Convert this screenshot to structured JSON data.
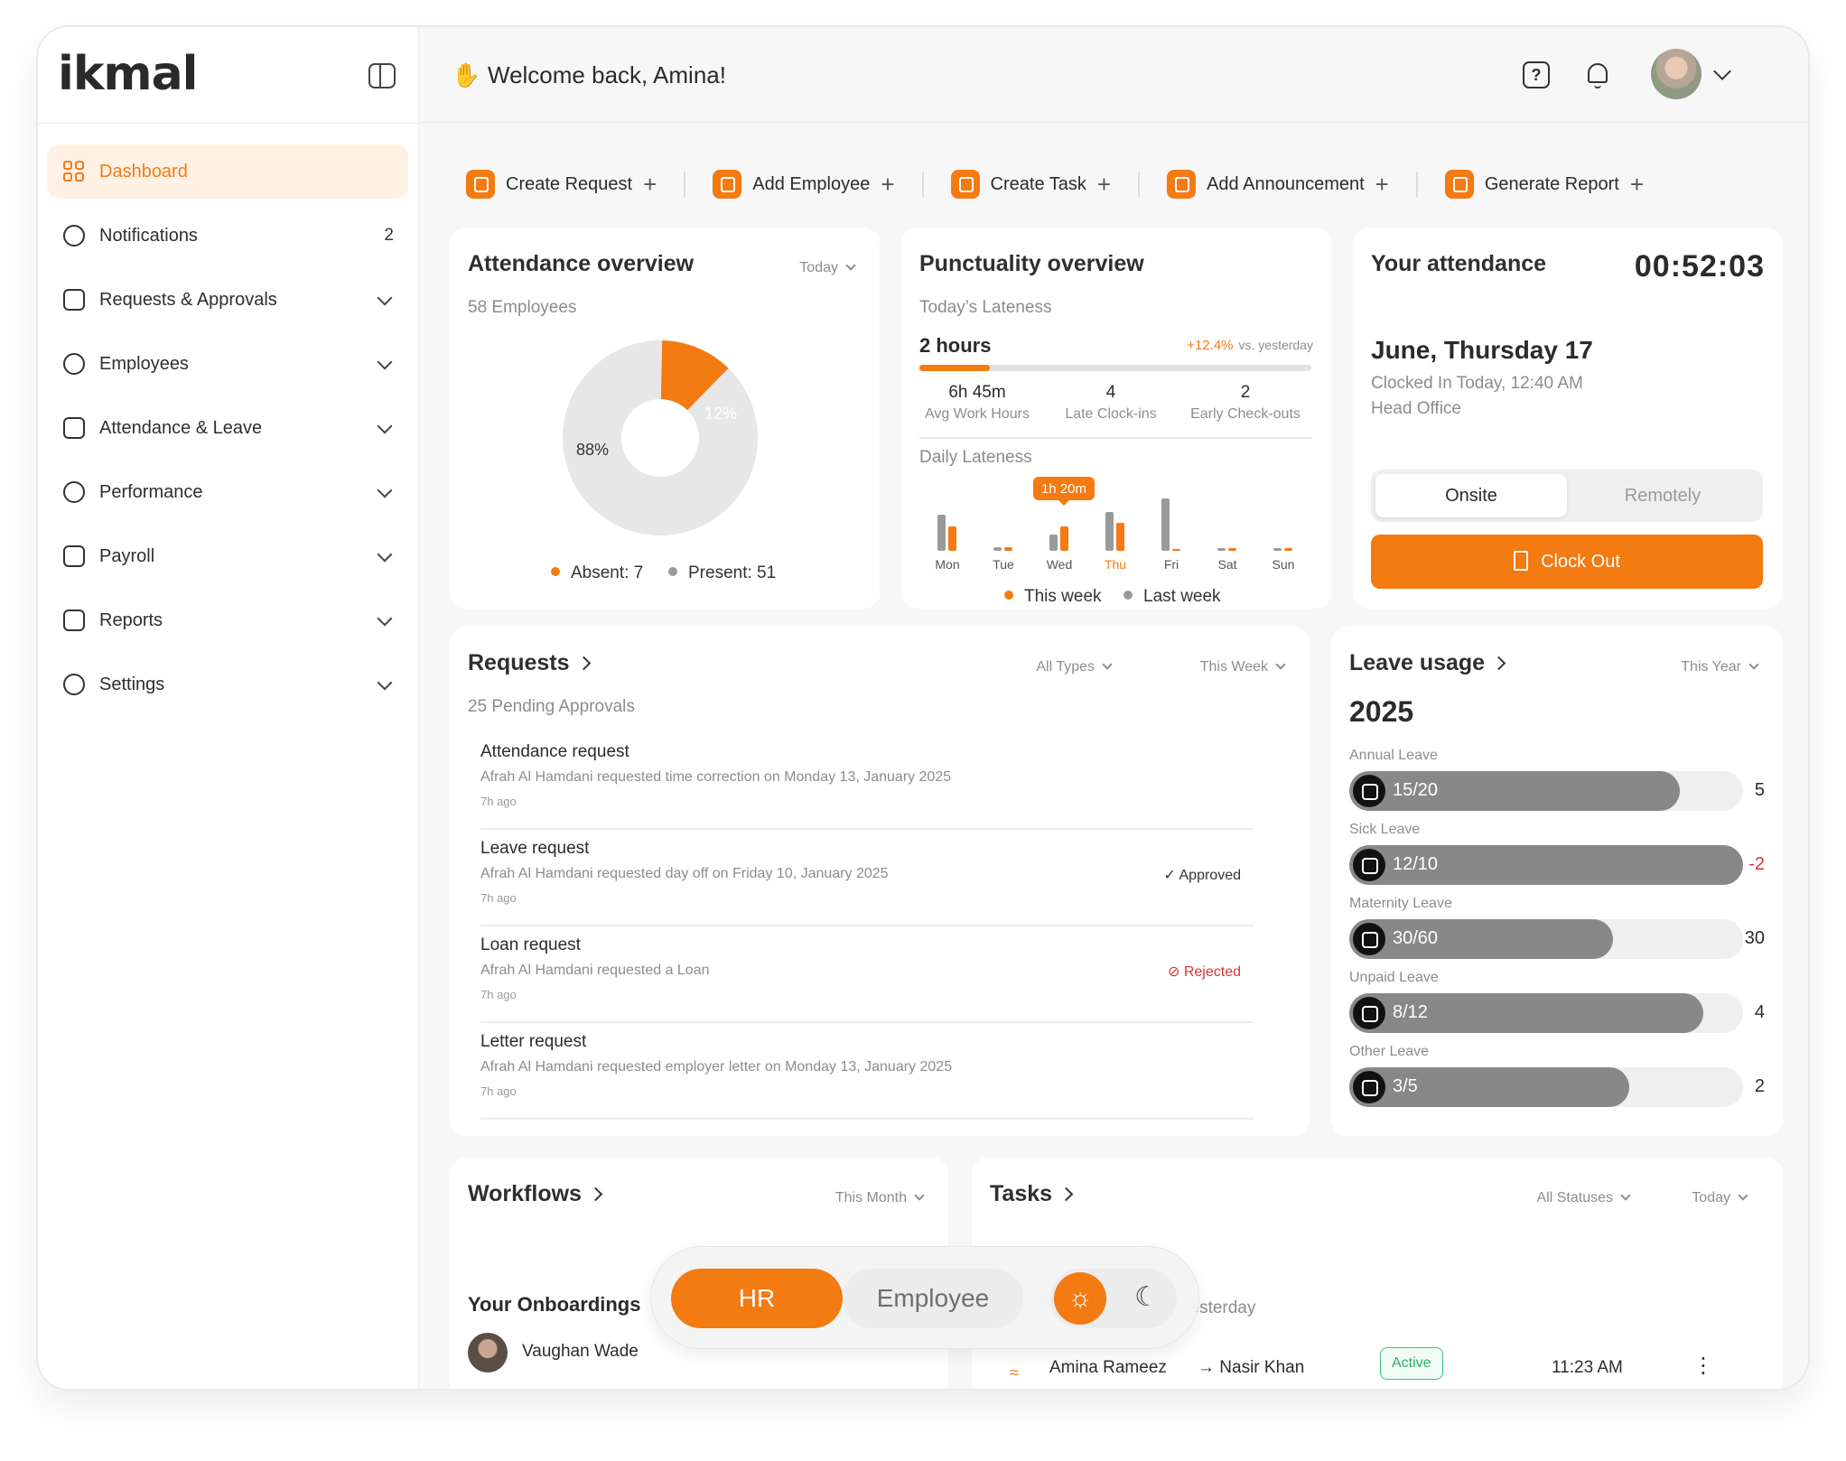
{
  "brand": {
    "name": "ikmal",
    "accent": "#f47a12"
  },
  "sidebar": {
    "items": [
      {
        "label": "Dashboard",
        "count": "",
        "active": true
      },
      {
        "label": "Notifications",
        "count": "2"
      },
      {
        "label": "Requests & Approvals"
      },
      {
        "label": "Employees"
      },
      {
        "label": "Attendance & Leave"
      },
      {
        "label": "Performance"
      },
      {
        "label": "Payroll"
      },
      {
        "label": "Reports"
      },
      {
        "label": "Settings"
      }
    ]
  },
  "header": {
    "welcome": "Welcome back, Amina!",
    "help_icon": "?"
  },
  "actions": [
    {
      "label": "Create Request",
      "icon": "request-icon"
    },
    {
      "label": "Add Employee",
      "icon": "user-icon"
    },
    {
      "label": "Create Task",
      "icon": "task-icon"
    },
    {
      "label": "Add Announcement",
      "icon": "bell-icon"
    },
    {
      "label": "Generate Report",
      "icon": "chart-icon"
    }
  ],
  "attendance_overview": {
    "title": "Attendance overview",
    "filter": "Today",
    "subtitle": "58 Employees",
    "absent_pct": "12%",
    "present_pct": "88%",
    "legend_absent": "Absent: 7",
    "legend_present": "Present: 51"
  },
  "punctuality": {
    "title": "Punctuality overview",
    "subtitle": "Today’s Lateness",
    "value": "2 hours",
    "change": "+12.4%",
    "change_note": "vs. yesterday",
    "progress": 0.18,
    "stats": [
      {
        "value": "6h 45m",
        "label": "Avg Work Hours"
      },
      {
        "value": "4",
        "label": "Late Clock-ins"
      },
      {
        "value": "2",
        "label": "Early Check-outs"
      }
    ],
    "daily_label": "Daily Lateness",
    "tooltip": "1h 20m",
    "legend_this": "This week",
    "legend_last": "Last week"
  },
  "chart_data": {
    "type": "bar",
    "categories": [
      "Mon",
      "Tue",
      "Wed",
      "Thu",
      "Fri",
      "Sat",
      "Sun"
    ],
    "series": [
      {
        "name": "Last week",
        "values": [
          40,
          4,
          18,
          43,
          58,
          3,
          3
        ]
      },
      {
        "name": "This week",
        "values": [
          27,
          4,
          27,
          31,
          0,
          3,
          3
        ]
      }
    ],
    "highlight_category": "Thu",
    "ylim": [
      0,
      62
    ]
  },
  "your_attendance": {
    "title": "Your attendance",
    "timer": "00:52:03",
    "date": "June, Thursday 17",
    "clocked": "Clocked In Today, 12:40 AM",
    "location": "Head Office",
    "seg_on": "Onsite",
    "seg_off": "Remotely",
    "button": "Clock Out"
  },
  "requests": {
    "title": "Requests",
    "filter_type": "All Types",
    "filter_time": "This Week",
    "subtitle": "25 Pending Approvals",
    "items": [
      {
        "title": "Attendance request",
        "desc": "Afrah Al Hamdani requested time correction on Monday 13, January 2025",
        "ago": "7h ago",
        "status": ""
      },
      {
        "title": "Leave request",
        "desc": "Afrah Al Hamdani requested day off on Friday 10, January 2025",
        "ago": "7h ago",
        "status": "Approved"
      },
      {
        "title": "Loan request",
        "desc": "Afrah Al Hamdani requested a Loan",
        "ago": "7h ago",
        "status": "Rejected"
      },
      {
        "title": "Letter request",
        "desc": "Afrah Al Hamdani requested employer letter on Monday 13, January 2025",
        "ago": "7h ago",
        "status": ""
      }
    ]
  },
  "leave_usage": {
    "title": "Leave usage",
    "filter": "This Year",
    "year": "2025",
    "items": [
      {
        "label": "Annual Leave",
        "value": "15/20",
        "fill": 0.84,
        "remaining": "5",
        "icon": "beach-icon"
      },
      {
        "label": "Sick Leave",
        "value": "12/10",
        "fill": 1.0,
        "remaining": "-2",
        "icon": "ambulance-icon"
      },
      {
        "label": "Maternity Leave",
        "value": "30/60",
        "fill": 0.67,
        "remaining": "30",
        "icon": "crib-icon"
      },
      {
        "label": "Unpaid Leave",
        "value": "8/12",
        "fill": 0.9,
        "remaining": "4",
        "icon": "dollar-icon"
      },
      {
        "label": "Other Leave",
        "value": "3/5",
        "fill": 0.71,
        "remaining": "2",
        "icon": "music-icon"
      }
    ]
  },
  "workflows": {
    "title": "Workflows",
    "filter": "This Month",
    "section": "Your Onboardings",
    "person": "Vaughan Wade"
  },
  "tasks": {
    "title": "Tasks",
    "filter_status": "All Statuses",
    "filter_time": "Today",
    "partial": "yesterday",
    "row": {
      "from": "Amina Rameez",
      "to": "→ Nasir Khan",
      "status": "Active",
      "time": "11:23 AM"
    }
  },
  "mode_toggle": {
    "hr": "HR",
    "employee": "Employee"
  }
}
